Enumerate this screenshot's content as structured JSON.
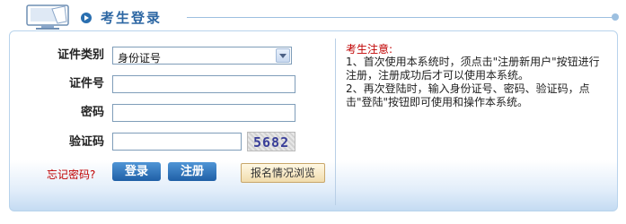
{
  "header": {
    "title": "考生登录"
  },
  "form": {
    "id_type_label": "证件类别",
    "id_type_value": "身份证号",
    "id_number_label": "证件号",
    "password_label": "密码",
    "captcha_label": "验证码",
    "captcha_image_text": "5682",
    "forgot_password": "忘记密码?",
    "login_button": "登录",
    "register_button": "注册",
    "browse_button": "报名情况浏览"
  },
  "notice": {
    "title": "考生注意:",
    "lines": [
      "1、首次使用本系统时，须点击\"注册新用户\"按钮进行注册，注册成功后才可以使用本系统。",
      "2、再次登陆时，输入身份证号、密码、验证码，点击\"登陆\"按钮即可使用和操作本系统。"
    ]
  },
  "colors": {
    "accent": "#2d67a3",
    "warning": "#c00000",
    "panel_border": "#b8d3ec"
  }
}
